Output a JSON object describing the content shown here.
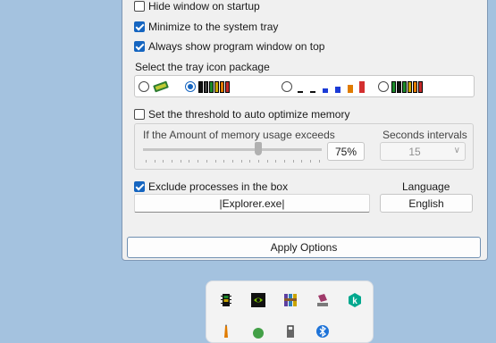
{
  "options": {
    "hide_window": {
      "label": "Hide window on startup",
      "checked": false
    },
    "minimize_tray": {
      "label": "Minimize to the system tray",
      "checked": true
    },
    "always_top": {
      "label": "Always show program window on top",
      "checked": true
    }
  },
  "tray_package": {
    "label": "Select the tray icon package",
    "selected_index": 1,
    "options": [
      {
        "name": "green-chip-icon"
      },
      {
        "name": "colored-bars-black-icon"
      },
      {
        "name": "colored-bars-white-icon"
      },
      {
        "name": "colored-bars-green-icon"
      }
    ]
  },
  "threshold": {
    "label": "Set the threshold to auto optimize memory",
    "checked": false,
    "amount_label": "If the Amount of memory usage exceeds",
    "amount_value": "75%",
    "slider_level": 0.62,
    "seconds_label": "Seconds intervals",
    "seconds_value": "15"
  },
  "exclude": {
    "label": "Exclude processes in the box",
    "checked": true,
    "value": "|Explorer.exe|"
  },
  "language": {
    "label": "Language",
    "value": "English"
  },
  "apply_button": "Apply Options",
  "colors": {
    "accent": "#1565c0",
    "desktop": "#a4c2df"
  },
  "tray_icons": [
    "memory-chip-icon",
    "nvidia-icon",
    "archive-icon",
    "stamp-icon",
    "kaspersky-icon",
    "pencil-icon",
    "green-app-icon",
    "usb-icon",
    "bluetooth-icon"
  ]
}
